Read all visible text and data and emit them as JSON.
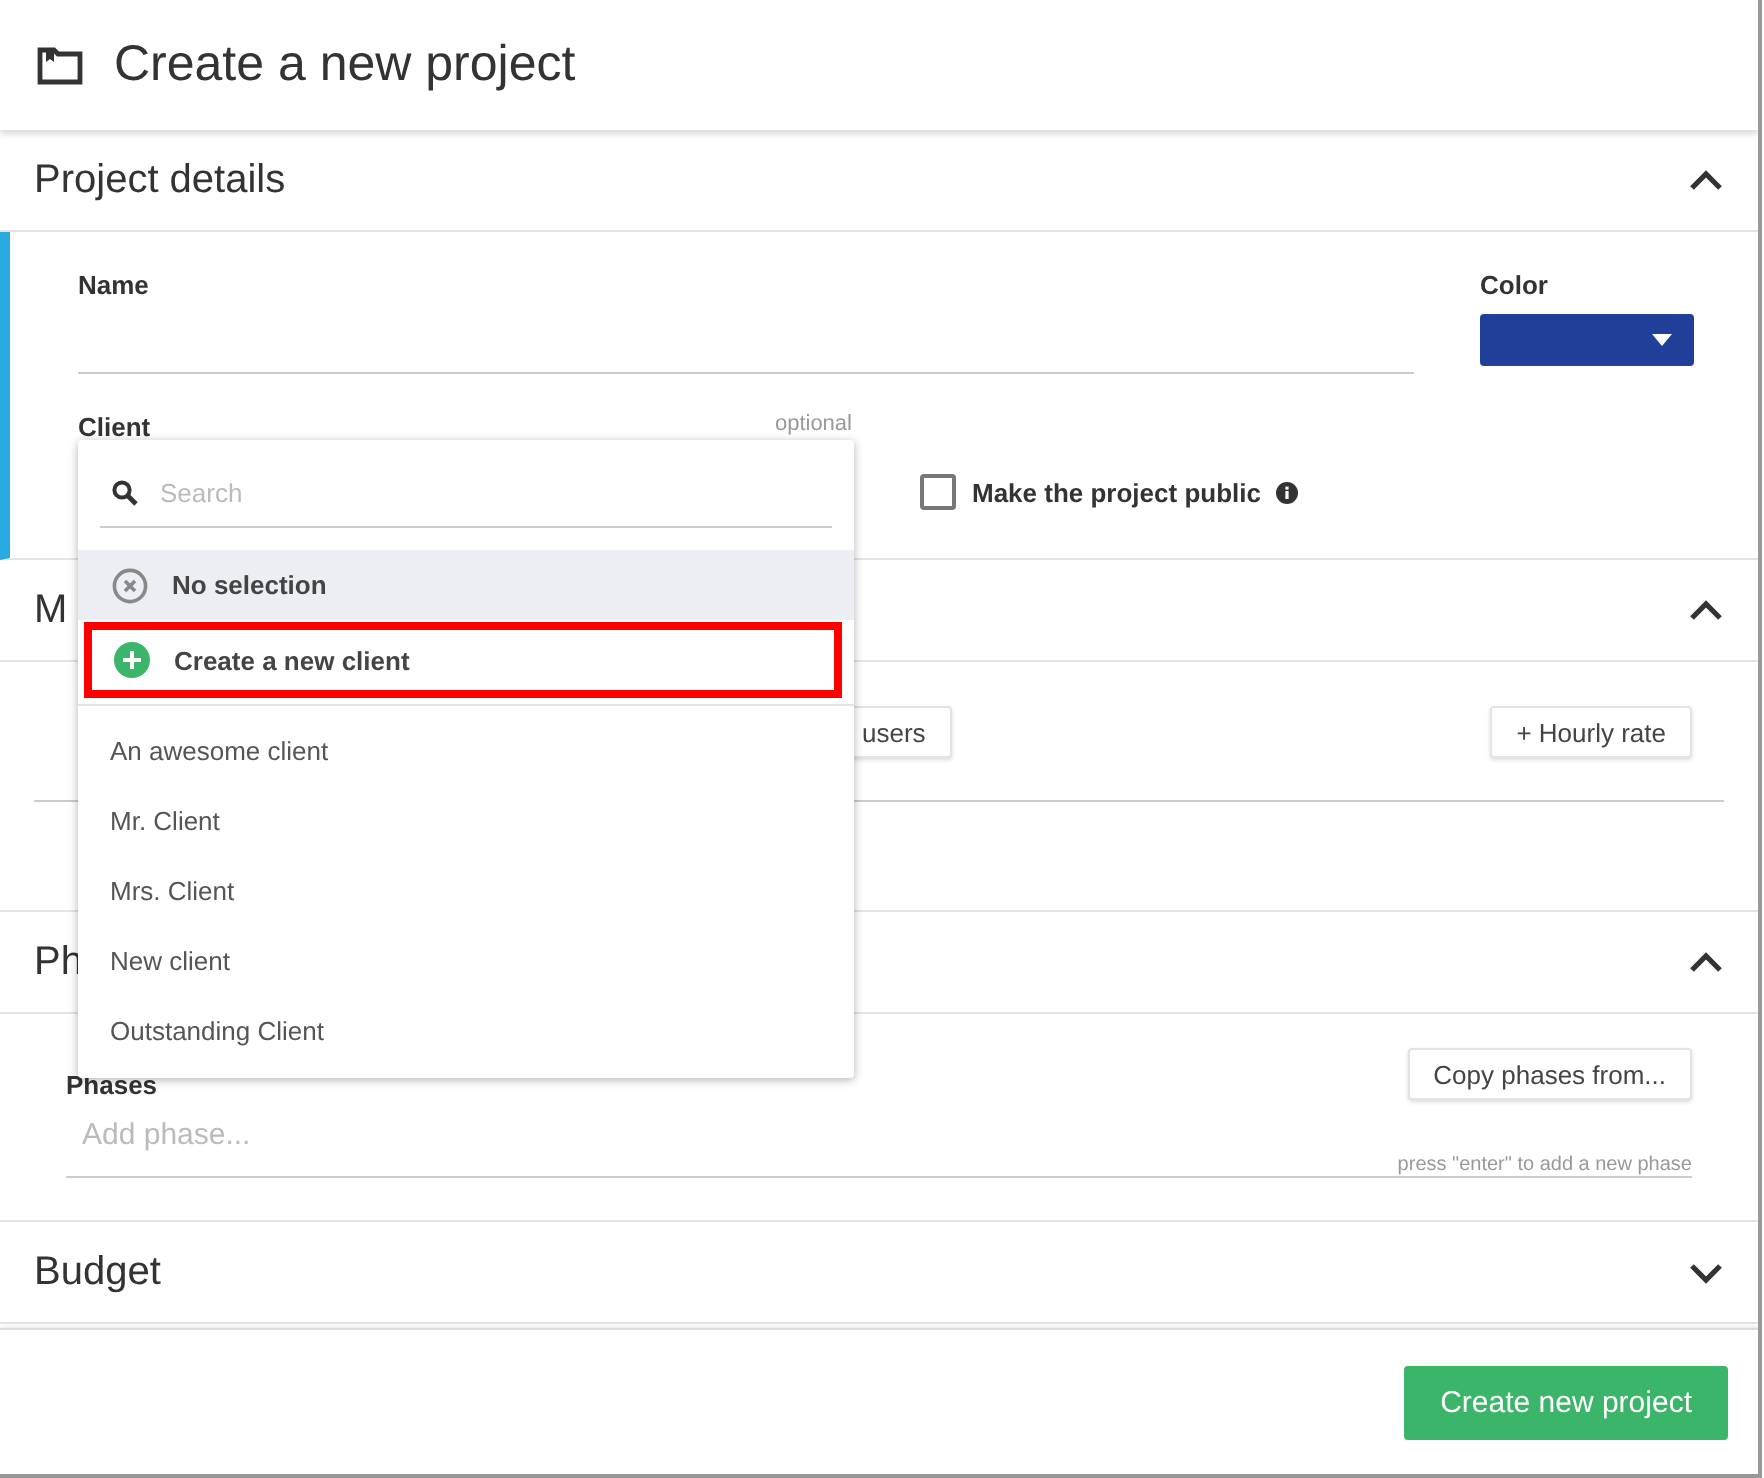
{
  "window": {
    "title": "Create a new project"
  },
  "project_details": {
    "title": "Project details",
    "expanded": true,
    "name_label": "Name",
    "color_label": "Color",
    "color": "#1f3f99",
    "client_label": "Client",
    "client_hint": "optional",
    "public": {
      "label": "Make the project public",
      "checked": false
    }
  },
  "members": {
    "title": "M",
    "expanded": true,
    "users_button": "users",
    "hourly_rate_button": "+ Hourly rate"
  },
  "phases": {
    "title": "Ph",
    "expanded": true,
    "label": "Phases",
    "copy_button": "Copy phases from...",
    "placeholder": "Add phase...",
    "hint": "press \"enter\" to add a new phase"
  },
  "budget": {
    "title": "Budget",
    "expanded": false
  },
  "client_dropdown": {
    "search_placeholder": "Search",
    "options": [
      {
        "kind": "clear",
        "label": "No selection",
        "selected": true,
        "highlighted": false
      },
      {
        "kind": "create",
        "label": "Create a new client",
        "selected": false,
        "highlighted": true
      },
      {
        "kind": "client",
        "label": "An awesome client",
        "selected": false,
        "highlighted": false
      },
      {
        "kind": "client",
        "label": "Mr. Client",
        "selected": false,
        "highlighted": false
      },
      {
        "kind": "client",
        "label": "Mrs. Client",
        "selected": false,
        "highlighted": false
      },
      {
        "kind": "client",
        "label": "New client",
        "selected": false,
        "highlighted": false
      },
      {
        "kind": "client",
        "label": "Outstanding Client",
        "selected": false,
        "highlighted": false
      }
    ]
  },
  "submit_button": "Create new project"
}
